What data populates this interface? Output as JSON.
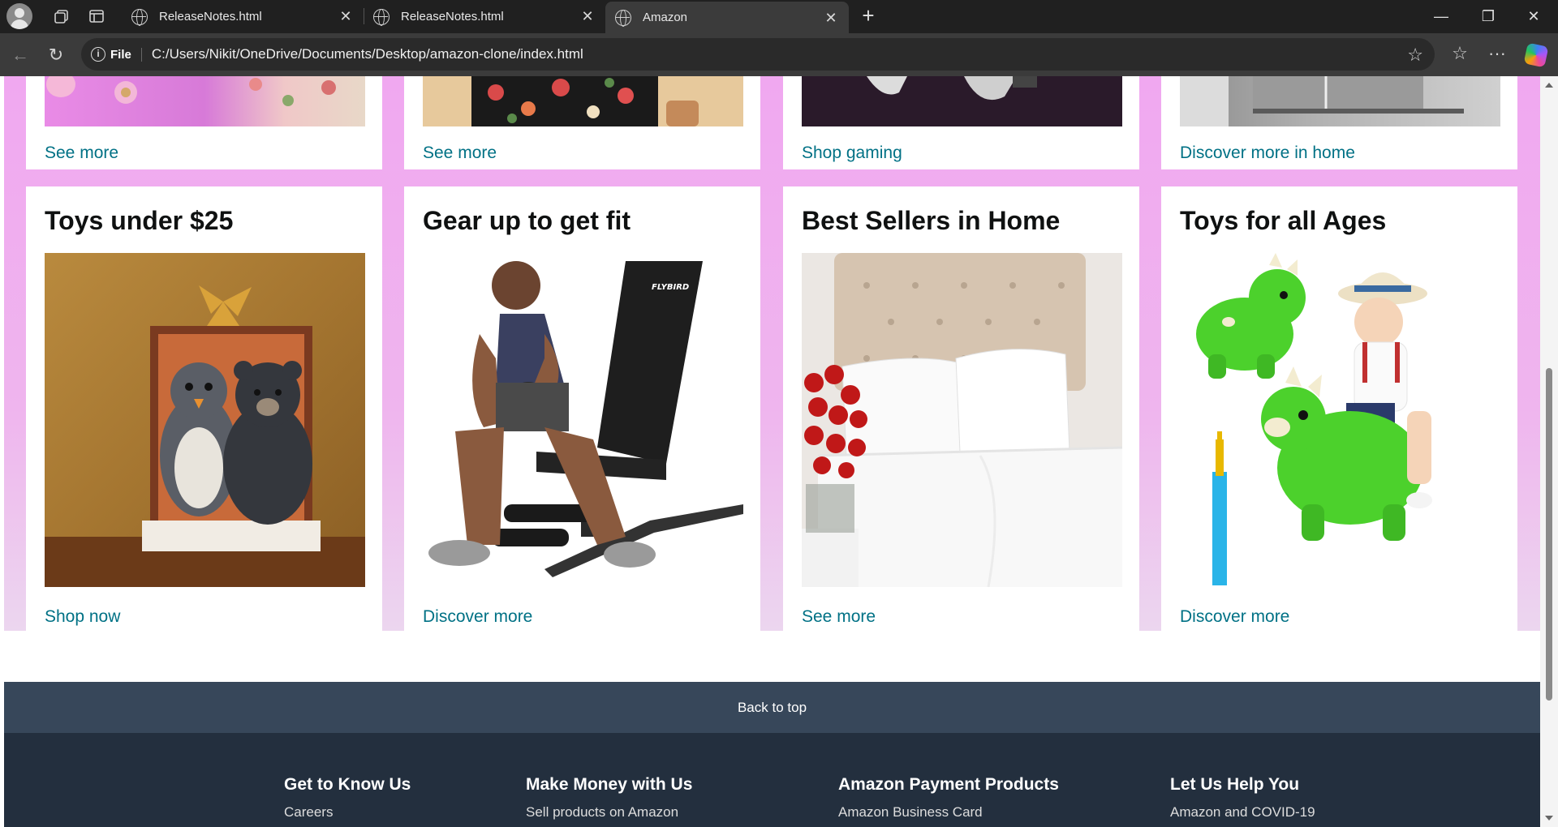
{
  "browser": {
    "tabs": [
      {
        "title": "ReleaseNotes.html"
      },
      {
        "title": "ReleaseNotes.html"
      },
      {
        "title": "Amazon"
      }
    ],
    "address": {
      "scheme_label": "File",
      "url": "C:/Users/Nikit/OneDrive/Documents/Desktop/amazon-clone/index.html"
    }
  },
  "top_row_links": [
    "See more",
    "See more",
    "Shop gaming",
    "Discover more in home"
  ],
  "cards": [
    {
      "title": "Toys under $25",
      "link": "Shop now"
    },
    {
      "title": "Gear up to get fit",
      "link": "Discover more"
    },
    {
      "title": "Best Sellers in Home",
      "link": "See more"
    },
    {
      "title": "Toys for all Ages",
      "link": "Discover more"
    }
  ],
  "back_to_top": "Back to top",
  "footer": {
    "columns": [
      {
        "heading": "Get to Know Us",
        "items": [
          "Careers"
        ]
      },
      {
        "heading": "Make Money with Us",
        "items": [
          "Sell products on Amazon"
        ]
      },
      {
        "heading": "Amazon Payment Products",
        "items": [
          "Amazon Business Card"
        ]
      },
      {
        "heading": "Let Us Help You",
        "items": [
          "Amazon and COVID-19"
        ]
      }
    ]
  },
  "colors": {
    "page_background": "#f0a8f0",
    "link": "#007185",
    "back_to_top_bg": "#37475a",
    "footer_bg": "#232f3e"
  }
}
